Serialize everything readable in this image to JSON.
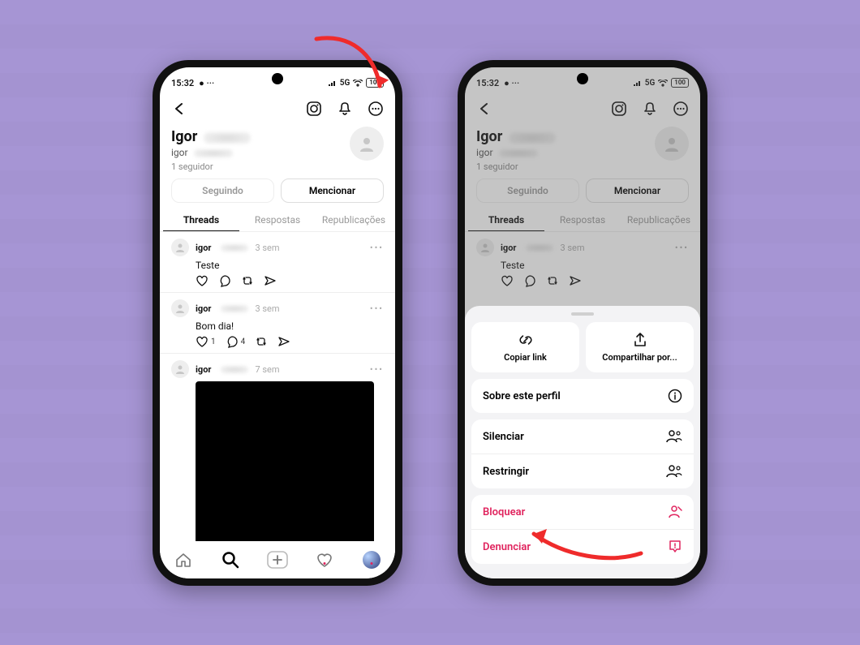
{
  "colors": {
    "accent_red": "#ef2b2b",
    "danger": "#e0245e",
    "background": "#a695d4"
  },
  "status": {
    "time": "15:32",
    "network": "5G",
    "battery": "100"
  },
  "profile": {
    "display_name_visible": "Igor",
    "handle_visible": "igor",
    "followers_line": "1 seguidor"
  },
  "buttons": {
    "following": "Seguindo",
    "mention": "Mencionar"
  },
  "tabs": {
    "threads": "Threads",
    "replies": "Respostas",
    "reposts": "Republicações"
  },
  "posts": [
    {
      "user_visible": "igor",
      "age": "3 sem",
      "body": "Teste",
      "likes": "",
      "comments": ""
    },
    {
      "user_visible": "igor",
      "age": "3 sem",
      "body": "Bom dia!",
      "likes": "1",
      "comments": "4"
    },
    {
      "user_visible": "igor",
      "age": "7 sem",
      "body": "",
      "has_image": true
    }
  ],
  "sheet": {
    "copy_link": "Copiar link",
    "share_via": "Compartilhar por...",
    "about": "Sobre este perfil",
    "mute": "Silenciar",
    "restrict": "Restringir",
    "block": "Bloquear",
    "report": "Denunciar"
  }
}
